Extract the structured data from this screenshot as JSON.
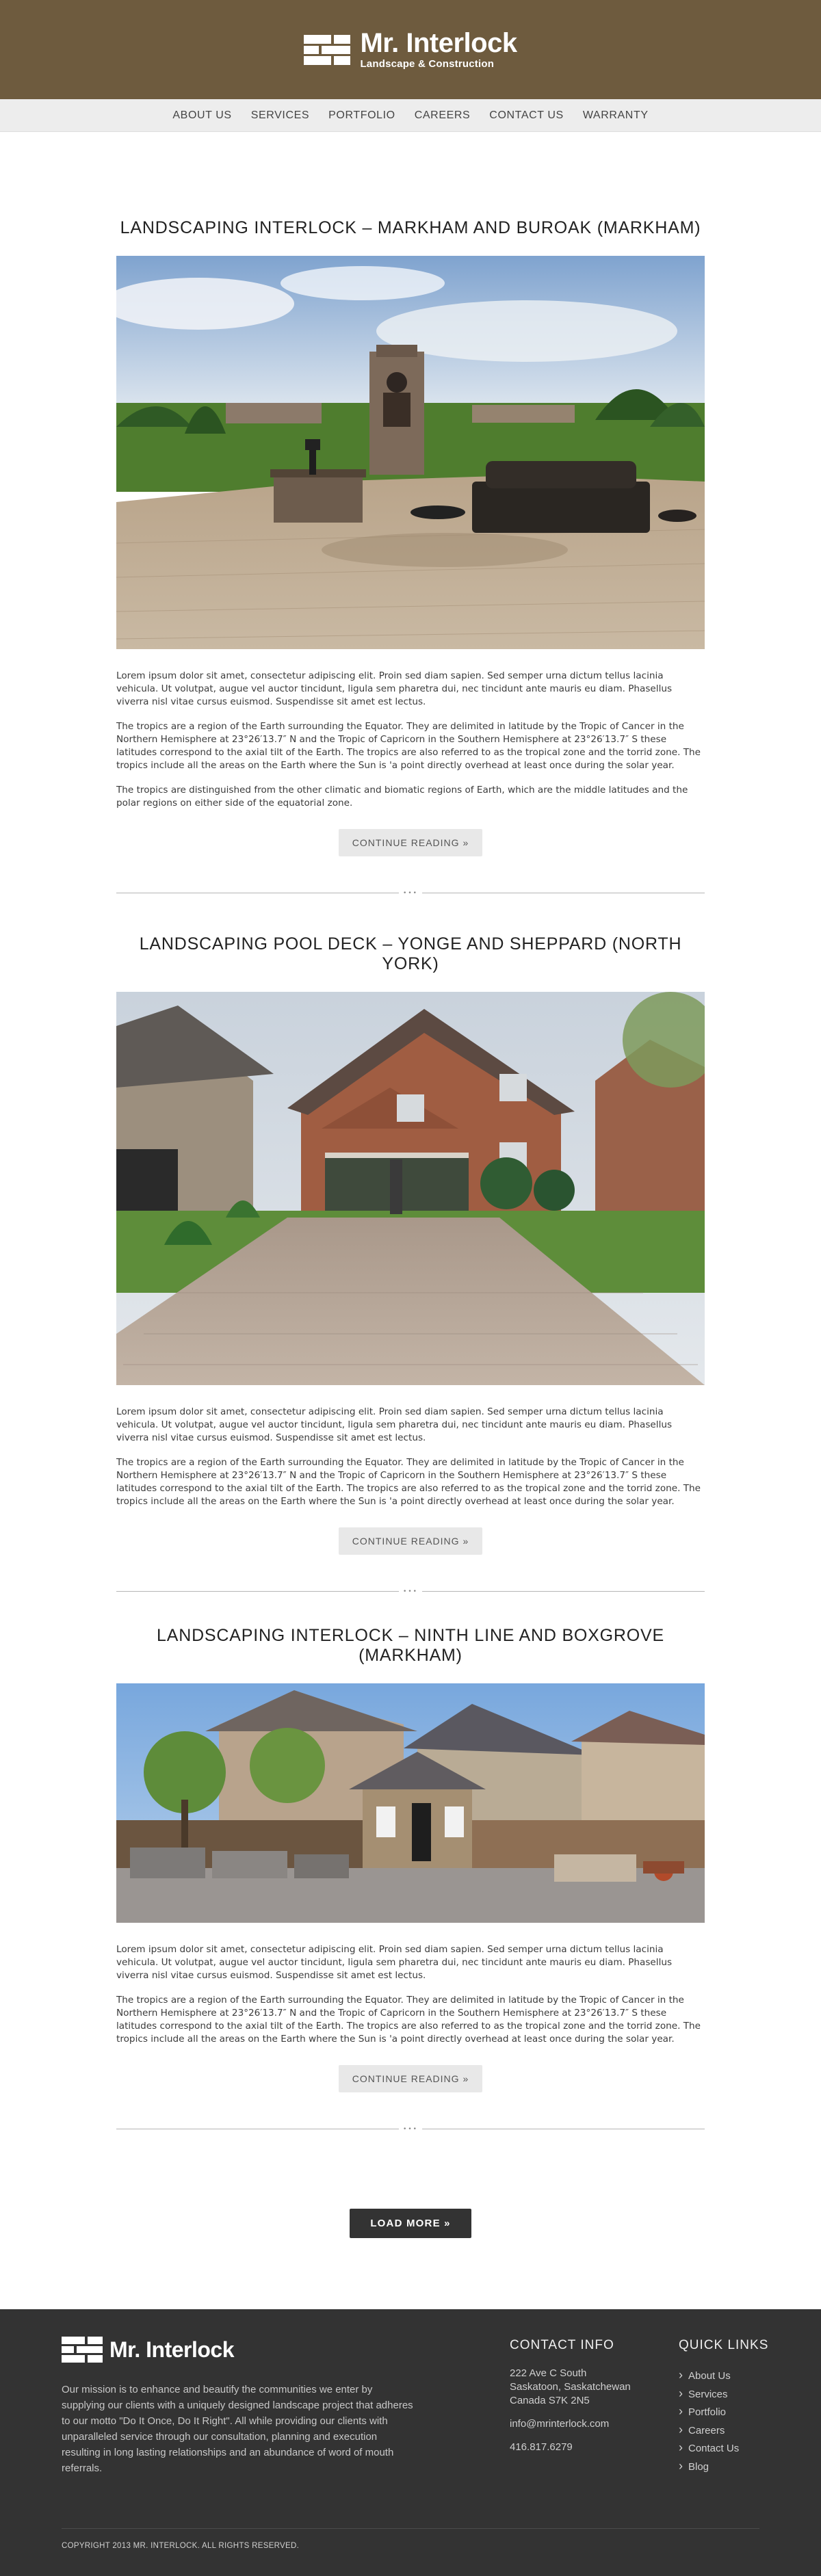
{
  "header": {
    "logo_title": "Mr. Interlock",
    "logo_subtitle": "Landscape & Construction",
    "brand_color": "#6e5b3e"
  },
  "nav": {
    "items": [
      "ABOUT US",
      "SERVICES",
      "PORTFOLIO",
      "CAREERS",
      "CONTACT US",
      "WARRANTY"
    ]
  },
  "posts": [
    {
      "title": "LANDSCAPING INTERLOCK – MARKHAM AND BUROAK (MARKHAM)",
      "paragraphs": [
        "Lorem ipsum dolor sit amet, consectetur adipiscing elit. Proin sed diam sapien. Sed semper urna dictum tellus lacinia vehicula. Ut volutpat, augue vel auctor tincidunt, ligula sem pharetra dui, nec tincidunt ante mauris eu diam. Phasellus viverra nisl vitae cursus euismod. Suspendisse sit amet est lectus.",
        "The tropics are a region of the Earth surrounding the Equator. They are delimited in latitude by the Tropic of Cancer in the Northern Hemisphere at 23°26′13.7″ N and the Tropic of Capricorn in the Southern Hemisphere at 23°26′13.7″ S these latitudes correspond to the axial tilt of the Earth. The tropics are also referred to as the tropical zone and the torrid zone. The tropics include all the areas on the Earth where the Sun is 'a point directly overhead at least once during the solar year.",
        "The tropics are distinguished from the other climatic and biomatic regions of Earth, which are the middle latitudes and the polar regions on either side of the equatorial zone."
      ],
      "button": "CONTINUE READING »"
    },
    {
      "title": "LANDSCAPING POOL DECK – YONGE AND SHEPPARD (NORTH YORK)",
      "paragraphs": [
        "Lorem ipsum dolor sit amet, consectetur adipiscing elit. Proin sed diam sapien. Sed semper urna dictum tellus lacinia vehicula. Ut volutpat, augue vel auctor tincidunt, ligula sem pharetra dui, nec tincidunt ante mauris eu diam. Phasellus viverra nisl vitae cursus euismod. Suspendisse sit amet est lectus.",
        "The tropics are a region of the Earth surrounding the Equator. They are delimited in latitude by the Tropic of Cancer in the Northern Hemisphere at 23°26′13.7″ N and the Tropic of Capricorn in the Southern Hemisphere at 23°26′13.7″ S these latitudes correspond to the axial tilt of the Earth. The tropics are also referred to as the tropical zone and the torrid zone. The tropics include all the areas on the Earth where the Sun is 'a point directly overhead at least once during the solar year."
      ],
      "button": "CONTINUE READING »"
    },
    {
      "title": "LANDSCAPING INTERLOCK – NINTH LINE AND BOXGROVE (MARKHAM)",
      "paragraphs": [
        "Lorem ipsum dolor sit amet, consectetur adipiscing elit. Proin sed diam sapien. Sed semper urna dictum tellus lacinia vehicula. Ut volutpat, augue vel auctor tincidunt, ligula sem pharetra dui, nec tincidunt ante mauris eu diam. Phasellus viverra nisl vitae cursus euismod. Suspendisse sit amet est lectus.",
        "The tropics are a region of the Earth surrounding the Equator. They are delimited in latitude by the Tropic of Cancer in the Northern Hemisphere at 23°26′13.7″ N and the Tropic of Capricorn in the Southern Hemisphere at 23°26′13.7″ S these latitudes correspond to the axial tilt of the Earth. The tropics are also referred to as the tropical zone and the torrid zone. The tropics include all the areas on the Earth where the Sun is 'a point directly overhead at least once during the solar year."
      ],
      "button": "CONTINUE READING »"
    }
  ],
  "divider_dots": "•••",
  "load_more": "LOAD MORE »",
  "footer": {
    "logo_title": "Mr. Interlock",
    "mission": "Our mission is to enhance and beautify the communities we enter by supplying our clients with a uniquely designed landscape project that adheres to our motto \"Do It Once, Do It Right\". All while providing our clients with unparalleled service through our consultation, planning and execution resulting in long lasting relationships and an abundance of word of mouth referrals.",
    "contact_title": "CONTACT INFO",
    "address_line1": "222 Ave C South",
    "address_line2": "Saskatoon, Saskatchewan",
    "address_line3": "Canada S7K 2N5",
    "email": "info@mrinterlock.com",
    "phone": "416.817.6279",
    "links_title": "QUICK LINKS",
    "links": [
      "About Us",
      "Services",
      "Portfolio",
      "Careers",
      "Contact Us",
      "Blog"
    ],
    "copyright": "COPYRIGHT 2013 MR. INTERLOCK. ALL RIGHTS RESERVED.",
    "background": "#333333"
  }
}
